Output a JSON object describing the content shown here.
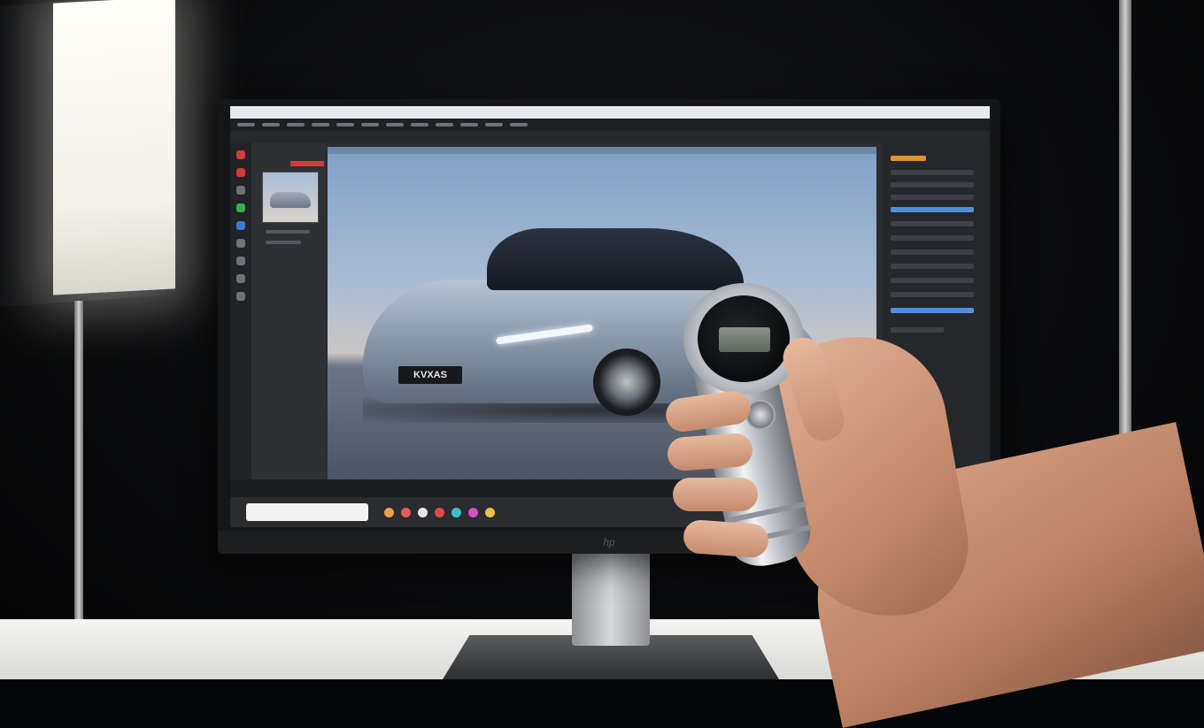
{
  "scene": {
    "description_free": true,
    "monitor": {
      "logo": "hp"
    },
    "car_plate": "KVXAS"
  },
  "colors": {
    "sky_top": "#7fa0c7",
    "car_body": "#9aa7b7",
    "device_metal": "#c5c9ce",
    "accent_active": "#4f8fe0",
    "accent_red": "#d43a3a",
    "accent_green": "#2fb24a"
  },
  "taskbar_icons": [
    "#f0a048",
    "#e85a5a",
    "#e6e6e6",
    "#e04a4a",
    "#3ac0d0",
    "#d94fc4",
    "#f0c040"
  ]
}
